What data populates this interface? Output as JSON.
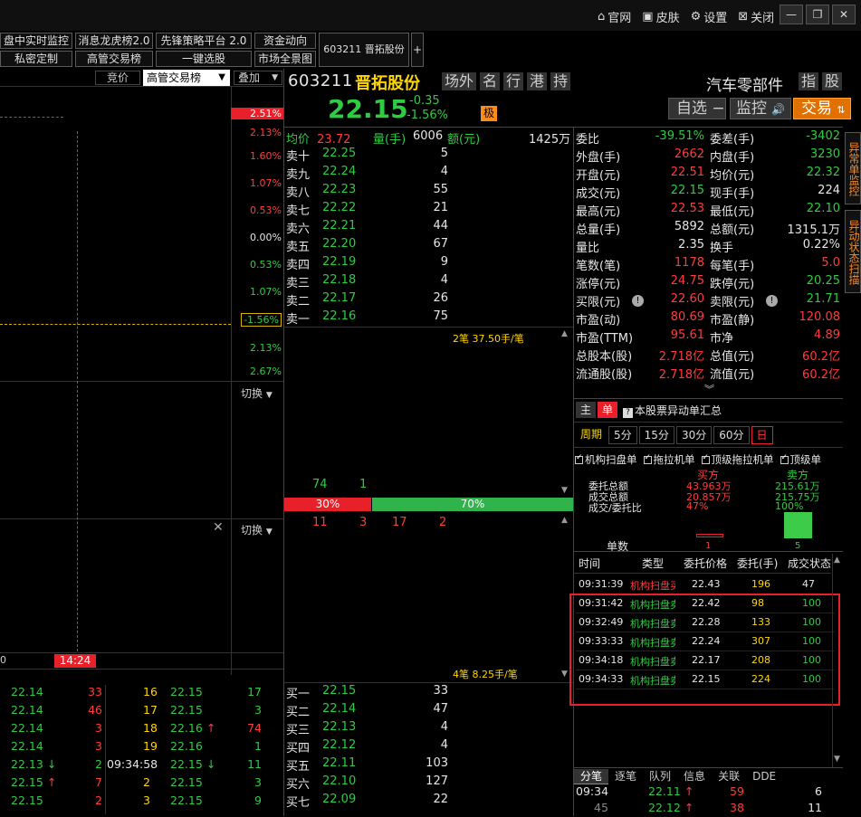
{
  "topbar": {
    "home": "官网",
    "skin": "皮肤",
    "settings": "设置",
    "close": "关闭"
  },
  "nav": {
    "r1": [
      "盘中实时监控",
      "消息龙虎榜2.0",
      "先锋策略平台 2.0",
      "资金动向"
    ],
    "r2": [
      "私密定制",
      "高管交易榜",
      "一键选股",
      "市场全景图"
    ],
    "stock_tab": "603211 晋拓股份",
    "plus": "+"
  },
  "chart_toolbar": {
    "bid": "竞价",
    "select": "高管交易榜",
    "overlay": "叠加"
  },
  "axis_pcts": [
    {
      "v": "2.51%",
      "c": "hl"
    },
    {
      "v": "2.13%",
      "c": "red"
    },
    {
      "v": "1.60%",
      "c": "red"
    },
    {
      "v": "1.07%",
      "c": "red"
    },
    {
      "v": "0.53%",
      "c": "red"
    },
    {
      "v": "0.00%",
      "c": "white"
    },
    {
      "v": "0.53%",
      "c": "green"
    },
    {
      "v": "1.07%",
      "c": "green"
    },
    {
      "v": "-1.56%",
      "c": "box"
    },
    {
      "v": "2.13%",
      "c": "green"
    },
    {
      "v": "2.67%",
      "c": "green"
    }
  ],
  "switch1": "切换",
  "switch2": "切换",
  "time_mark": "14:24",
  "stock": {
    "code": "603211",
    "name": "晋拓股份",
    "price": "22.15",
    "chg": "-0.35",
    "chgpct": "-1.56%",
    "limit_badge": "极",
    "tags": [
      "场外",
      "名",
      "行",
      "港",
      "持"
    ],
    "industry": "汽车零部件",
    "tags2": [
      "指",
      "股"
    ],
    "self": "自选",
    "monitor": "监控",
    "trade": "交易"
  },
  "quote_head": {
    "avg_label": "均价",
    "avg": "23.72",
    "vol_label": "量(手)",
    "vol": "6006",
    "amt_label": "额(元)",
    "amt": "1425万"
  },
  "sells": [
    {
      "l": "卖十",
      "p": "22.25",
      "v": "5"
    },
    {
      "l": "卖九",
      "p": "22.24",
      "v": "4"
    },
    {
      "l": "卖八",
      "p": "22.23",
      "v": "55"
    },
    {
      "l": "卖七",
      "p": "22.22",
      "v": "21"
    },
    {
      "l": "卖六",
      "p": "22.21",
      "v": "44"
    },
    {
      "l": "卖五",
      "p": "22.20",
      "v": "67"
    },
    {
      "l": "卖四",
      "p": "22.19",
      "v": "9"
    },
    {
      "l": "卖三",
      "p": "22.18",
      "v": "4"
    },
    {
      "l": "卖二",
      "p": "22.17",
      "v": "26"
    },
    {
      "l": "卖一",
      "p": "22.16",
      "v": "75"
    }
  ],
  "sell_note": "2笔 37.50手/笔",
  "pressure": {
    "n1": "74",
    "n2": "1",
    "left": "30%",
    "right": "70%",
    "b1": "11",
    "b2": "3",
    "b3": "17",
    "b4": "2"
  },
  "buy_note": "4笔 8.25手/笔",
  "buys": [
    {
      "l": "买一",
      "p": "22.15",
      "v": "33"
    },
    {
      "l": "买二",
      "p": "22.14",
      "v": "47"
    },
    {
      "l": "买三",
      "p": "22.13",
      "v": "4"
    },
    {
      "l": "买四",
      "p": "22.12",
      "v": "4"
    },
    {
      "l": "买五",
      "p": "22.11",
      "v": "103"
    },
    {
      "l": "买六",
      "p": "22.10",
      "v": "127"
    },
    {
      "l": "买七",
      "p": "22.09",
      "v": "22"
    }
  ],
  "stats": [
    {
      "a": "委比",
      "av": "-39.51%",
      "ac": "green",
      "b": "委差(手)",
      "bv": "-3402",
      "bc": "green"
    },
    {
      "a": "外盘(手)",
      "av": "2662",
      "ac": "red",
      "b": "内盘(手)",
      "bv": "3230",
      "bc": "green"
    },
    {
      "a": "开盘(元)",
      "av": "22.51",
      "ac": "red",
      "b": "均价(元)",
      "bv": "22.32",
      "bc": "green"
    },
    {
      "a": "成交(元)",
      "av": "22.15",
      "ac": "green",
      "b": "现手(手)",
      "bv": "224",
      "bc": "white"
    },
    {
      "a": "最高(元)",
      "av": "22.53",
      "ac": "red",
      "b": "最低(元)",
      "bv": "22.10",
      "bc": "green"
    },
    {
      "a": "总量(手)",
      "av": "5892",
      "ac": "white",
      "b": "总额(元)",
      "bv": "1315.1万",
      "bc": "white"
    },
    {
      "a": "量比",
      "av": "2.35",
      "ac": "white",
      "b": "换手",
      "bv": "0.22%",
      "bc": "white"
    },
    {
      "a": "笔数(笔)",
      "av": "1178",
      "ac": "red",
      "b": "每笔(手)",
      "bv": "5.0",
      "bc": "red"
    },
    {
      "a": "涨停(元)",
      "av": "24.75",
      "ac": "red",
      "b": "跌停(元)",
      "bv": "20.25",
      "bc": "green"
    },
    {
      "a": "买限(元)",
      "av": "22.60",
      "ac": "red",
      "b": "卖限(元)",
      "bv": "21.71",
      "bc": "green"
    },
    {
      "a": "市盈(动)",
      "av": "80.69",
      "ac": "red",
      "b": "市盈(静)",
      "bv": "120.08",
      "bc": "red"
    },
    {
      "a": "市盈(TTM)",
      "av": "95.61",
      "ac": "red",
      "b": "市净",
      "bv": "4.89",
      "bc": "red"
    },
    {
      "a": "总股本(股)",
      "av": "2.718亿",
      "ac": "red",
      "b": "总值(元)",
      "bv": "60.2亿",
      "bc": "red"
    },
    {
      "a": "流通股(股)",
      "av": "2.718亿",
      "ac": "red",
      "b": "流值(元)",
      "bv": "60.2亿",
      "bc": "red"
    }
  ],
  "side_tabs": [
    "异常单监控",
    "异动状态扫描"
  ],
  "main_tabs": {
    "t1": "主",
    "t2": "单",
    "summary": "本股票异动单汇总"
  },
  "periods": [
    "周期",
    "5分",
    "15分",
    "30分",
    "60分",
    "日"
  ],
  "filters": [
    "机构扫盘单",
    "拖拉机单",
    "顶级拖拉机单",
    "顶级单"
  ],
  "summary_tbl": {
    "buy": "买方",
    "sell": "卖方",
    "rows": [
      {
        "l": "委托总额",
        "b": "43.963万",
        "s": "215.61万"
      },
      {
        "l": "成交总额",
        "b": "20.857万",
        "s": "215.75万"
      },
      {
        "l": "成交/委托比",
        "b": "47%",
        "s": "100%"
      }
    ],
    "single": "单数",
    "bcount": "1",
    "scount": "5"
  },
  "orders_head": [
    "时间",
    "类型",
    "委托价格",
    "委托(手)",
    "成交状态"
  ],
  "orders": [
    {
      "t": "09:31:39",
      "type": "机构扫盘买",
      "p": "22.43",
      "q": "196",
      "s": "47",
      "tc": "red"
    },
    {
      "t": "09:31:42",
      "type": "机构扫盘卖",
      "p": "22.42",
      "q": "98",
      "s": "100",
      "tc": "green"
    },
    {
      "t": "09:32:49",
      "type": "机构扫盘卖",
      "p": "22.28",
      "q": "133",
      "s": "100",
      "tc": "green"
    },
    {
      "t": "09:33:33",
      "type": "机构扫盘卖",
      "p": "22.24",
      "q": "307",
      "s": "100",
      "tc": "green"
    },
    {
      "t": "09:34:18",
      "type": "机构扫盘卖",
      "p": "22.17",
      "q": "208",
      "s": "100",
      "tc": "green"
    },
    {
      "t": "09:34:33",
      "type": "机构扫盘卖",
      "p": "22.15",
      "q": "224",
      "s": "100",
      "tc": "green"
    }
  ],
  "bottom_tabs": [
    "分笔",
    "逐笔",
    "队列",
    "信息",
    "关联",
    "DDE"
  ],
  "ticks_right": [
    {
      "t": "09:34",
      "p": "22.11",
      "v": "59",
      "n": "6"
    },
    {
      "t": "45",
      "p": "22.12",
      "v": "38",
      "n": "11"
    }
  ],
  "ticks_left": [
    {
      "a": "22.14",
      "av": "33",
      "b": "16",
      "bv": "22.15",
      "bvv": "17"
    },
    {
      "a": "22.14",
      "av": "46",
      "b": "17",
      "bv": "22.15",
      "bvv": "3"
    },
    {
      "a": "22.14",
      "av": "3",
      "b": "18",
      "bv": "22.16",
      "bvv": "74"
    },
    {
      "a": "22.14",
      "av": "3",
      "b": "19",
      "bv": "22.16",
      "bvv": "1"
    },
    {
      "a": "22.13",
      "av": "2",
      "b": "09:34:58",
      "bv": "22.15",
      "bvv": "11"
    },
    {
      "a": "22.15",
      "av": "7",
      "b": "2",
      "bv": "22.15",
      "bvv": "3"
    },
    {
      "a": "22.15",
      "av": "2",
      "b": "3",
      "bv": "22.15",
      "bvv": "9"
    }
  ],
  "tick0": "0"
}
